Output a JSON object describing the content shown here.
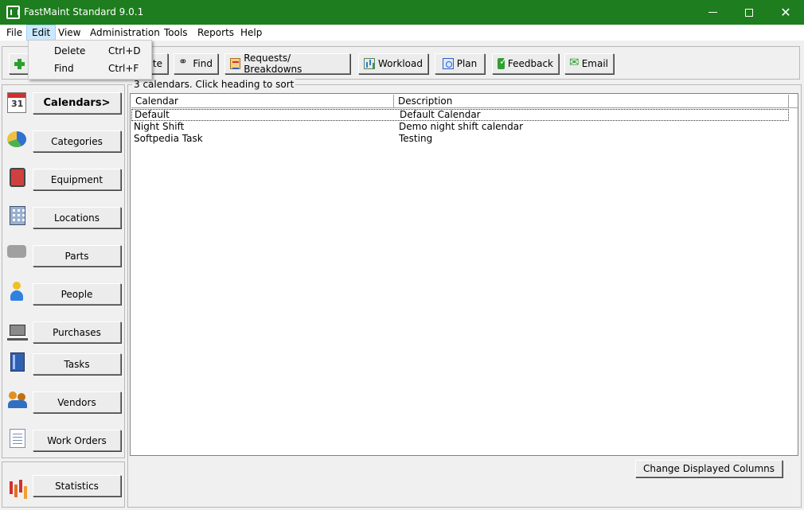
{
  "window": {
    "title": "FastMaint Standard 9.0.1",
    "minimize_glyph": "",
    "close_glyph": "✕"
  },
  "menubar": {
    "items": [
      "File",
      "Edit",
      "View",
      "Administration",
      "Tools",
      "Reports",
      "Help"
    ],
    "active": "Edit"
  },
  "edit_menu": {
    "items": [
      {
        "label": "Delete",
        "shortcut": "Ctrl+D"
      },
      {
        "label": "Find",
        "shortcut": "Ctrl+F"
      }
    ]
  },
  "toolbar": {
    "buttons": [
      {
        "label": "",
        "icon": "plus-icon"
      },
      {
        "label": "te",
        "icon": "none"
      },
      {
        "label": "Find",
        "icon": "glasses-icon"
      },
      {
        "label": "Requests/ Breakdowns",
        "icon": "clipboard-icon"
      },
      {
        "label": "Workload",
        "icon": "chart-icon"
      },
      {
        "label": "Plan",
        "icon": "plan-icon"
      },
      {
        "label": "Feedback",
        "icon": "check-icon"
      },
      {
        "label": "Email",
        "icon": "email-icon"
      }
    ]
  },
  "sidebar": {
    "items": [
      {
        "label": "Calendars>",
        "icon": "calendar-icon",
        "selected": true
      },
      {
        "label": "Categories",
        "icon": "pie-chart-icon"
      },
      {
        "label": "Equipment",
        "icon": "equipment-icon"
      },
      {
        "label": "Locations",
        "icon": "building-icon"
      },
      {
        "label": "Parts",
        "icon": "parts-icon"
      },
      {
        "label": "People",
        "icon": "person-icon"
      },
      {
        "label": "Purchases",
        "icon": "cart-icon"
      },
      {
        "label": "Tasks",
        "icon": "book-icon"
      },
      {
        "label": "Vendors",
        "icon": "group-icon"
      },
      {
        "label": "Work Orders",
        "icon": "document-icon"
      }
    ],
    "statistics": {
      "label": "Statistics",
      "icon": "bar-chart-icon"
    }
  },
  "main": {
    "status": "3 calendars. Click heading to sort",
    "columns": [
      "Calendar",
      "Description"
    ],
    "rows": [
      {
        "calendar": "Default",
        "description": "Default Calendar"
      },
      {
        "calendar": "Night Shift",
        "description": "Demo night shift calendar"
      },
      {
        "calendar": "Softpedia Task",
        "description": "Testing"
      }
    ],
    "change_columns_label": "Change Displayed Columns"
  },
  "colors": {
    "titlebar": "#1e7d1e",
    "menu_highlight": "#cce8ff"
  }
}
